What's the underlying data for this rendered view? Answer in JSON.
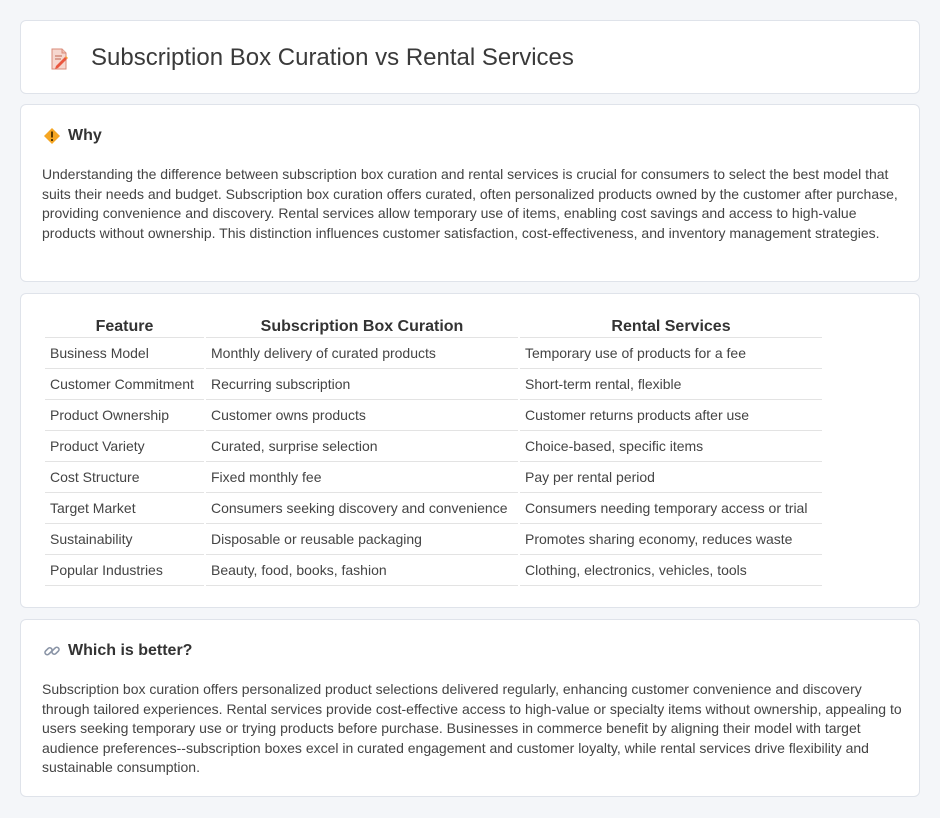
{
  "header": {
    "title": "Subscription Box Curation vs Rental Services",
    "icon": "document-edit-icon"
  },
  "why": {
    "heading": "Why",
    "icon": "warning-diamond-icon",
    "text": "Understanding the difference between subscription box curation and rental services is crucial for consumers to select the best model that suits their needs and budget. Subscription box curation offers curated, often personalized products owned by the customer after purchase, providing convenience and discovery. Rental services allow temporary use of items, enabling cost savings and access to high-value products without ownership. This distinction influences customer satisfaction, cost-effectiveness, and inventory management strategies."
  },
  "table": {
    "headers": [
      "Feature",
      "Subscription Box Curation",
      "Rental Services"
    ],
    "rows": [
      [
        "Business Model",
        "Monthly delivery of curated products",
        "Temporary use of products for a fee"
      ],
      [
        "Customer Commitment",
        "Recurring subscription",
        "Short-term rental, flexible"
      ],
      [
        "Product Ownership",
        "Customer owns products",
        "Customer returns products after use"
      ],
      [
        "Product Variety",
        "Curated, surprise selection",
        "Choice-based, specific items"
      ],
      [
        "Cost Structure",
        "Fixed monthly fee",
        "Pay per rental period"
      ],
      [
        "Target Market",
        "Consumers seeking discovery and convenience",
        "Consumers needing temporary access or trial"
      ],
      [
        "Sustainability",
        "Disposable or reusable packaging",
        "Promotes sharing economy, reduces waste"
      ],
      [
        "Popular Industries",
        "Beauty, food, books, fashion",
        "Clothing, electronics, vehicles, tools"
      ]
    ]
  },
  "better": {
    "heading": "Which is better?",
    "icon": "link-icon",
    "text": "Subscription box curation offers personalized product selections delivered regularly, enhancing customer convenience and discovery through tailored experiences. Rental services provide cost-effective access to high-value or specialty items without ownership, appealing to users seeking temporary use or trying products before purchase. Businesses in commerce benefit by aligning their model with target audience preferences--subscription boxes excel in curated engagement and customer loyalty, while rental services drive flexibility and sustainable consumption."
  }
}
